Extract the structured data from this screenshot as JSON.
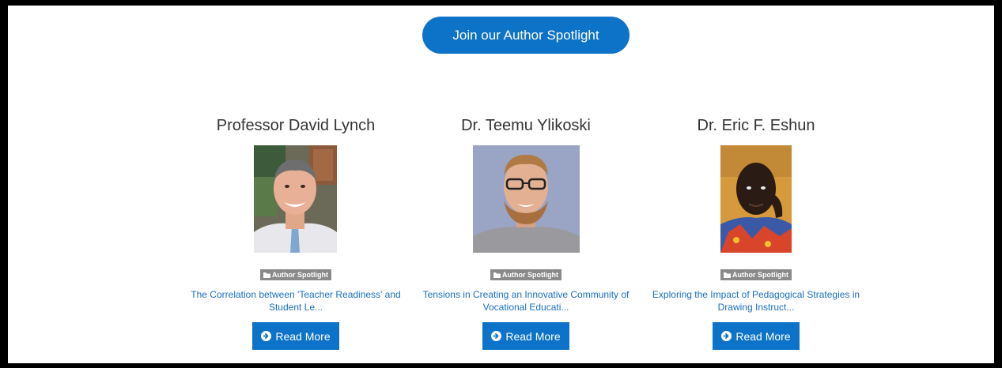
{
  "join_button": {
    "label": "Join our Author Spotlight"
  },
  "authors": [
    {
      "name": "Professor David Lynch",
      "category": "Author Spotlight",
      "article": "The Correlation between 'Teacher Readiness' and   Student Le...",
      "read_more": "Read More"
    },
    {
      "name": "Dr. Teemu Ylikoski",
      "category": "Author Spotlight",
      "article": "Tensions in Creating an Innovative Community of Vocational Educati...",
      "read_more": "Read More"
    },
    {
      "name": "Dr. Eric F. Eshun",
      "category": "Author Spotlight",
      "article": "Exploring the Impact of Pedagogical Strategies in Drawing Instruct...",
      "read_more": "Read More"
    }
  ],
  "colors": {
    "accent": "#0d73c8",
    "link": "#1a6fbf",
    "badge": "#8a8a8a",
    "frame": "#000000"
  },
  "icons": {
    "badge_icon": "folder-icon",
    "button_icon": "arrow-circle-right-icon"
  }
}
